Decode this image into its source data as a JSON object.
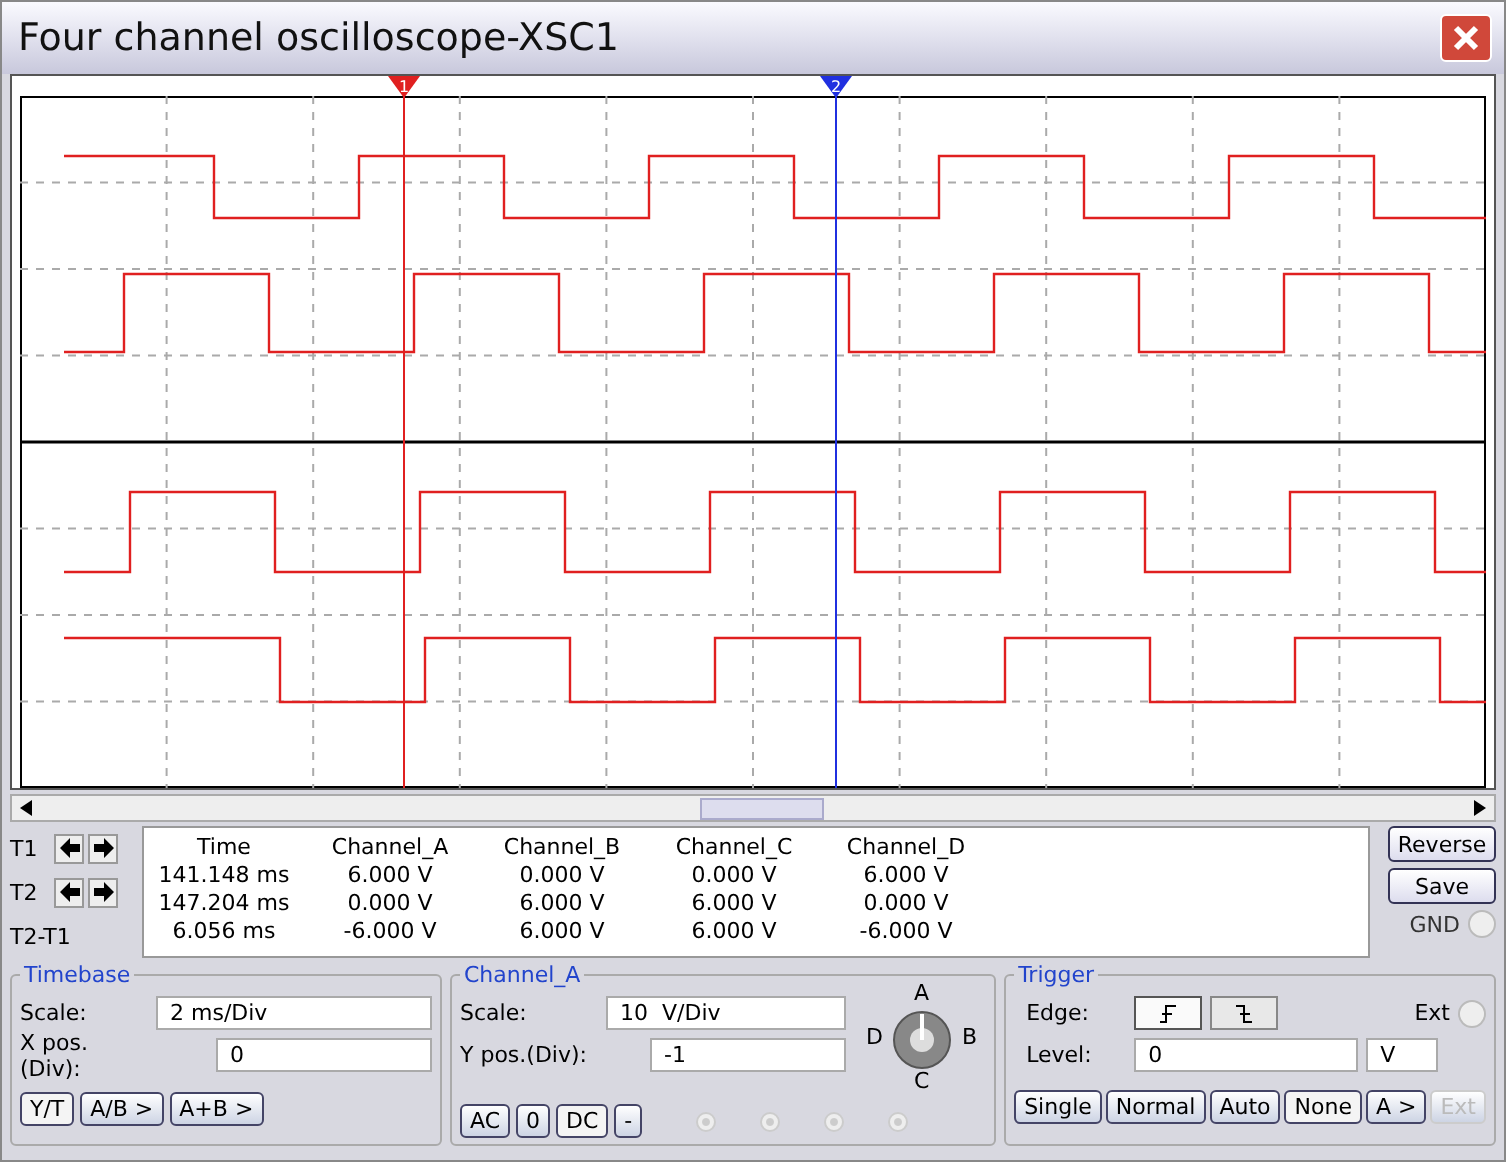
{
  "window": {
    "title": "Four channel oscilloscope-XSC1"
  },
  "cursors": [
    {
      "label": "1",
      "kind": "t1"
    },
    {
      "label": "2",
      "kind": "t2"
    }
  ],
  "readout": {
    "row_labels": [
      "T1",
      "T2",
      "T2-T1"
    ],
    "columns": [
      "Time",
      "Channel_A",
      "Channel_B",
      "Channel_C",
      "Channel_D"
    ],
    "rows": [
      [
        "141.148 ms",
        "6.000 V",
        "0.000 V",
        "0.000 V",
        "6.000 V"
      ],
      [
        "147.204 ms",
        "0.000 V",
        "6.000 V",
        "6.000 V",
        "0.000 V"
      ],
      [
        "6.056 ms",
        "-6.000 V",
        "6.000 V",
        "6.000 V",
        "-6.000 V"
      ]
    ]
  },
  "side_buttons": [
    "Reverse",
    "Save"
  ],
  "gnd": {
    "label": "GND",
    "checked": false
  },
  "timebase": {
    "title": "Timebase",
    "scale_label": "Scale:",
    "scale": "2 ms/Div",
    "xpos_label": "X pos.(Div):",
    "xpos": "0",
    "modes": [
      {
        "label": "Y/T",
        "selected": true
      },
      {
        "label": "A/B >",
        "selected": false
      },
      {
        "label": "A+B >",
        "selected": false
      }
    ]
  },
  "channel": {
    "title": "Channel_A",
    "scale_label": "Scale:",
    "scale": "10  V/Div",
    "ypos_label": "Y pos.(Div):",
    "ypos": "-1",
    "coupling": [
      {
        "label": "AC",
        "selected": false
      },
      {
        "label": "0",
        "selected": false
      },
      {
        "label": "DC",
        "selected": true
      },
      {
        "label": "-",
        "selected": false
      }
    ],
    "selector": [
      {
        "label": "A"
      },
      {
        "label": "B"
      },
      {
        "label": "C"
      },
      {
        "label": "D"
      }
    ]
  },
  "trigger": {
    "title": "Trigger",
    "edge_label": "Edge:",
    "edges": [
      {
        "kind": "rising",
        "selected": true
      },
      {
        "kind": "falling",
        "selected": false
      }
    ],
    "ext_label": "Ext",
    "ext_checked": false,
    "level_label": "Level:",
    "level": "0",
    "unit": "V",
    "modes": [
      {
        "label": "Single",
        "selected": false,
        "disabled": false
      },
      {
        "label": "Normal",
        "selected": false,
        "disabled": false
      },
      {
        "label": "Auto",
        "selected": false,
        "disabled": false
      },
      {
        "label": "None",
        "selected": true,
        "disabled": false
      },
      {
        "label": "A >",
        "selected": false,
        "disabled": false
      },
      {
        "label": "Ext",
        "selected": false,
        "disabled": true
      }
    ]
  }
}
